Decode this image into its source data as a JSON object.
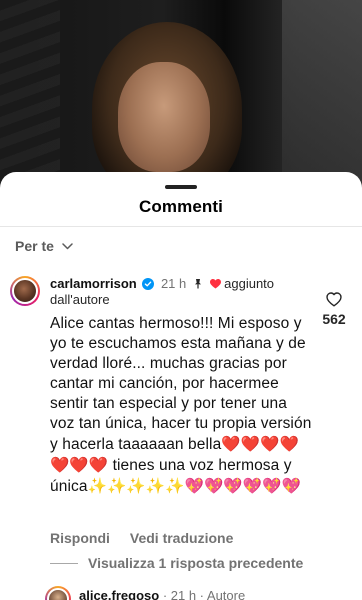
{
  "sheet": {
    "title": "Commenti",
    "filter_label": "Per te"
  },
  "comment": {
    "username": "carlamorrison",
    "time": "21 h",
    "liked_label_1": "aggiunto",
    "liked_label_2": "dall'autore",
    "like_count": "562",
    "body_text": "Alice cantas hermoso!!! Mi esposo y yo te escuchamos esta mañana y de verdad lloré... muchas gracias por cantar mi canción, por hacermee sentir tan especial y por tener una voz tan única, hacer tu propia versión y hacerla taaaaaan bella",
    "body_text_2": " tienes una voz hermosa y única",
    "reply_label": "Rispondi",
    "translate_label": "Vedi traduzione",
    "view_replies_label": "Visualizza 1 risposta precedente"
  },
  "reply": {
    "username": "alice.fregoso",
    "meta": " · 21 h · Autore"
  },
  "icons": {
    "verified": "verified-badge-icon",
    "pin": "pin-icon",
    "heart": "heart-icon",
    "like": "heart-outline-icon",
    "chevron": "chevron-down-icon"
  },
  "colors": {
    "verified_blue": "#0095f6",
    "heart_red": "#ff3040",
    "muted_text": "#737373"
  }
}
